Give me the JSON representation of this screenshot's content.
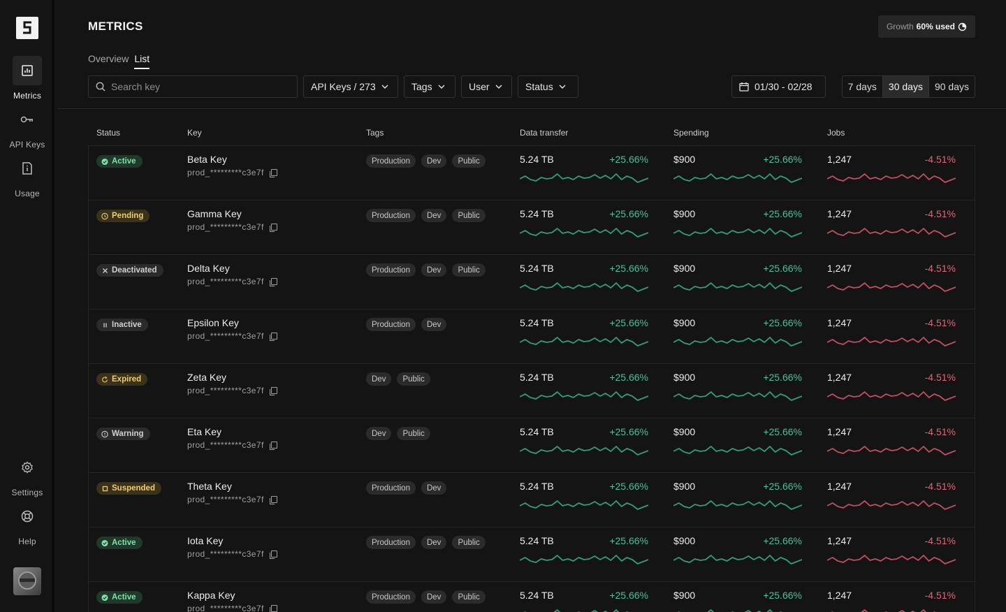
{
  "sidebar": {
    "logo": "S",
    "items": [
      {
        "label": "Metrics",
        "icon": "bar-chart-icon"
      },
      {
        "label": "API Keys",
        "icon": "key-icon"
      },
      {
        "label": "Usage",
        "icon": "document-info-icon"
      }
    ],
    "bottom_items": [
      {
        "label": "Settings",
        "icon": "gear-icon"
      },
      {
        "label": "Help",
        "icon": "lifebuoy-icon"
      }
    ]
  },
  "header": {
    "title": "METRICS",
    "growth_label": "Growth",
    "growth_value": "60% used",
    "tabs": [
      {
        "label": "Overview"
      },
      {
        "label": "List"
      }
    ],
    "active_tab": "List"
  },
  "toolbar": {
    "search_placeholder": "Search key",
    "filters": [
      "API Keys / 273",
      "Tags",
      "User",
      "Status"
    ],
    "date_range": "01/30 - 02/28",
    "ranges": [
      "7 days",
      "30 days",
      "90 days"
    ],
    "active_range": "30 days"
  },
  "table": {
    "columns": [
      "Status",
      "Key",
      "Tags",
      "Data transfer",
      "Spending",
      "Jobs"
    ],
    "rows": [
      {
        "status": "Active",
        "name": "Beta Key",
        "id": "prod_*********c3e7f",
        "tags": [
          "Production",
          "Dev",
          "Public"
        ],
        "data_transfer": "5.24 TB",
        "data_change": "+25.66%",
        "spending": "$900",
        "spending_change": "+25.66%",
        "jobs": "1,247",
        "jobs_change": "-4.51%"
      },
      {
        "status": "Pending",
        "name": "Gamma Key",
        "id": "prod_*********c3e7f",
        "tags": [
          "Production",
          "Dev",
          "Public"
        ],
        "data_transfer": "5.24 TB",
        "data_change": "+25.66%",
        "spending": "$900",
        "spending_change": "+25.66%",
        "jobs": "1,247",
        "jobs_change": "-4.51%"
      },
      {
        "status": "Deactivated",
        "name": "Delta Key",
        "id": "prod_*********c3e7f",
        "tags": [
          "Production",
          "Dev",
          "Public"
        ],
        "data_transfer": "5.24 TB",
        "data_change": "+25.66%",
        "spending": "$900",
        "spending_change": "+25.66%",
        "jobs": "1,247",
        "jobs_change": "-4.51%"
      },
      {
        "status": "Inactive",
        "name": "Epsilon Key",
        "id": "prod_*********c3e7f",
        "tags": [
          "Production",
          "Dev"
        ],
        "data_transfer": "5.24 TB",
        "data_change": "+25.66%",
        "spending": "$900",
        "spending_change": "+25.66%",
        "jobs": "1,247",
        "jobs_change": "-4.51%"
      },
      {
        "status": "Expired",
        "name": "Zeta Key",
        "id": "prod_*********c3e7f",
        "tags": [
          "Dev",
          "Public"
        ],
        "data_transfer": "5.24 TB",
        "data_change": "+25.66%",
        "spending": "$900",
        "spending_change": "+25.66%",
        "jobs": "1,247",
        "jobs_change": "-4.51%"
      },
      {
        "status": "Warning",
        "name": "Eta Key",
        "id": "prod_*********c3e7f",
        "tags": [
          "Dev",
          "Public"
        ],
        "data_transfer": "5.24 TB",
        "data_change": "+25.66%",
        "spending": "$900",
        "spending_change": "+25.66%",
        "jobs": "1,247",
        "jobs_change": "-4.51%"
      },
      {
        "status": "Suspended",
        "name": "Theta Key",
        "id": "prod_*********c3e7f",
        "tags": [
          "Production",
          "Dev"
        ],
        "data_transfer": "5.24 TB",
        "data_change": "+25.66%",
        "spending": "$900",
        "spending_change": "+25.66%",
        "jobs": "1,247",
        "jobs_change": "-4.51%"
      },
      {
        "status": "Active",
        "name": "Iota Key",
        "id": "prod_*********c3e7f",
        "tags": [
          "Production",
          "Dev",
          "Public"
        ],
        "data_transfer": "5.24 TB",
        "data_change": "+25.66%",
        "spending": "$900",
        "spending_change": "+25.66%",
        "jobs": "1,247",
        "jobs_change": "-4.51%"
      },
      {
        "status": "Active",
        "name": "Kappa Key",
        "id": "prod_*********c3e7f",
        "tags": [
          "Production",
          "Dev",
          "Public"
        ],
        "data_transfer": "5.24 TB",
        "data_change": "+25.66%",
        "spending": "$900",
        "spending_change": "+25.66%",
        "jobs": "1,247",
        "jobs_change": "-4.51%"
      }
    ]
  },
  "status_styles": {
    "Active": {
      "bg": "#1f3a2a",
      "fg": "#7fe0a8",
      "icon": "check-circle-icon"
    },
    "Pending": {
      "bg": "#3a321a",
      "fg": "#f0cd6a",
      "icon": "clock-icon"
    },
    "Deactivated": {
      "bg": "#2b2b2b",
      "fg": "#d0d0d0",
      "icon": "x-icon"
    },
    "Inactive": {
      "bg": "#2b2b2b",
      "fg": "#d0d0d0",
      "icon": "pause-icon"
    },
    "Expired": {
      "bg": "#3a321a",
      "fg": "#f0cd6a",
      "icon": "refresh-icon"
    },
    "Warning": {
      "bg": "#2b2b2b",
      "fg": "#d0d0d0",
      "icon": "alert-circle-icon"
    },
    "Suspended": {
      "bg": "#3a321a",
      "fg": "#f0cd6a",
      "icon": "stop-square-icon"
    }
  },
  "colors": {
    "positive": "#3fc49c",
    "negative": "#e5627a",
    "positive_line": "#2f9e7f",
    "negative_line": "#c04e64"
  },
  "sparkline": [
    0.55,
    0.35,
    0.6,
    0.7,
    0.45,
    0.55,
    0.5,
    0.2,
    0.55,
    0.45,
    0.6,
    0.35,
    0.5,
    0.45,
    0.25,
    0.5,
    0.3,
    0.55,
    0.2,
    0.6,
    0.35,
    0.5,
    0.8,
    0.65,
    0.5
  ]
}
